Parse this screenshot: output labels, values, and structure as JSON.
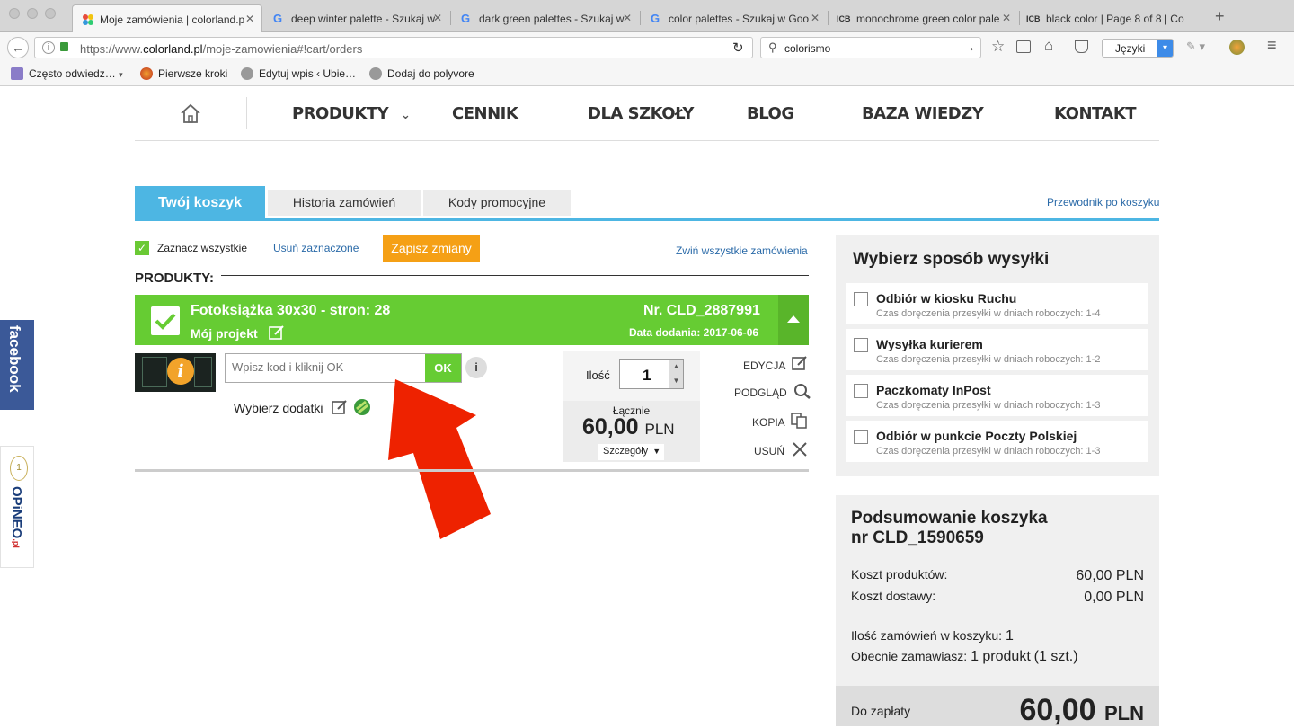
{
  "browser": {
    "tabs": [
      {
        "label": "Moje zamówienia | colorland.p",
        "active": true,
        "icon": "colorland-icon"
      },
      {
        "label": "deep winter palette - Szukaj w",
        "active": false,
        "icon": "google-icon"
      },
      {
        "label": "dark green palettes - Szukaj w",
        "active": false,
        "icon": "google-icon"
      },
      {
        "label": "color palettes - Szukaj w Goo",
        "active": false,
        "icon": "google-icon"
      },
      {
        "label": "monochrome green color pale",
        "active": false,
        "icon": "icb-icon"
      },
      {
        "label": "black color | Page 8 of 8 | Co",
        "active": false,
        "icon": "icb-icon"
      }
    ],
    "icb_text": "ICB",
    "url_prefix": "https://www.",
    "url_domain": "colorland.pl",
    "url_path": "/moje-zamowienia#!cart/orders",
    "search_value": "colorismo",
    "lang_button": "Języki",
    "bookmarks": [
      "Często odwiedz…",
      "Pierwsze kroki",
      "Edytuj wpis ‹ Ubie…",
      "Dodaj do polyvore"
    ]
  },
  "site_nav": {
    "items": [
      "PRODUKTY",
      "CENNIK",
      "DLA SZKOŁY",
      "BLOG",
      "BAZA WIEDZY",
      "KONTAKT"
    ]
  },
  "cart_tabs": {
    "active": "Twój koszyk",
    "history": "Historia zamówień",
    "promo": "Kody promocyjne",
    "guide": "Przewodnik po koszyku"
  },
  "toolbar": {
    "select_all": "Zaznacz wszystkie",
    "remove_selected": "Usuń zaznaczone",
    "save": "Zapisz zmiany",
    "collapse_all": "Zwiń wszystkie zamówienia"
  },
  "products_heading": "PRODUKTY:",
  "order": {
    "title": "Fotoksiążka 30x30 - stron: 28",
    "project": "Mój projekt",
    "number": "Nr. CLD_2887991",
    "date": "Data dodania: 2017-06-06",
    "code_placeholder": "Wpisz kod i kliknij OK",
    "ok": "OK",
    "info": "i",
    "extras": "Wybierz dodatki",
    "qty_label": "Ilość",
    "qty_value": "1",
    "total_label": "Łącznie",
    "total_value": "60,00",
    "currency": "PLN",
    "details": "Szczegóły",
    "actions": [
      "EDYCJA",
      "PODGLĄD",
      "KOPIA",
      "USUŃ"
    ]
  },
  "shipping": {
    "title": "Wybierz sposób wysyłki",
    "options": [
      {
        "name": "Odbiór w kiosku Ruchu",
        "time": "Czas doręczenia przesyłki w dniach roboczych: 1-4"
      },
      {
        "name": "Wysyłka kurierem",
        "time": "Czas doręczenia przesyłki w dniach roboczych: 1-2"
      },
      {
        "name": "Paczkomaty InPost",
        "time": "Czas doręczenia przesyłki w dniach roboczych: 1-3"
      },
      {
        "name": "Odbiór w punkcie Poczty Polskiej",
        "time": "Czas doręczenia przesyłki w dniach roboczych: 1-3"
      }
    ]
  },
  "summary": {
    "title_line1": "Podsumowanie koszyka",
    "title_line2": "nr CLD_1590659",
    "products_cost_label": "Koszt produktów:",
    "products_cost": "60,00 PLN",
    "delivery_cost_label": "Koszt dostawy:",
    "delivery_cost": "0,00 PLN",
    "orders_count_label": "Ilość zamówień w koszyku:",
    "orders_count": "1",
    "ordering_label": "Obecnie zamawiasz:",
    "ordering_value": "1 produkt",
    "ordering_qty": "(1 szt.)",
    "pay_label": "Do zapłaty",
    "pay_value": "60,00",
    "pay_currency": "PLN"
  },
  "social": {
    "facebook": "facebook",
    "opineo": "OPiNEO",
    "opineo_suffix": ".pl"
  },
  "colors": {
    "accent_blue": "#4db6e3",
    "green": "#66cc33",
    "orange": "#f5a015",
    "red_arrow": "#ee2200"
  }
}
